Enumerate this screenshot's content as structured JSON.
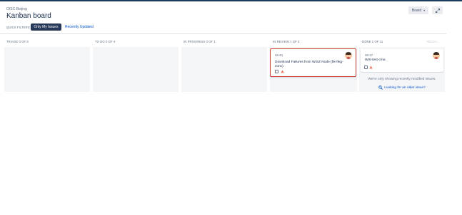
{
  "header": {
    "project": "OISC-Beijing",
    "title": "Kanban board",
    "board_label": "Board",
    "board_chevron": "▾",
    "expand_icon": "expand-icon"
  },
  "quick_filters": {
    "label": "QUICK FILTERS:",
    "items": [
      "Only My Issues",
      "Recently Updated"
    ]
  },
  "columns": [
    {
      "header": "TRIAGE 0 OF 8"
    },
    {
      "header": "TO DO 0 OF 4"
    },
    {
      "header": "IN PROGRESS 0 OF 1"
    },
    {
      "header": "IN REVIEW 1 OF 2"
    },
    {
      "header": "DONE 1 OF 11"
    }
  ],
  "columns_faded_tail": "RELEA...",
  "cards": [
    {
      "key": "WI-61",
      "summary": "Download Failures from WISZ Node (hk-hkg-zonc)",
      "selected": true
    },
    {
      "key": "WI-37",
      "summary": "IMS-test-cma",
      "selected": false
    }
  ],
  "done_notice": "We're only showing recently modified issues.",
  "done_older_link": "Looking for an older issue?",
  "colors": {
    "accent": "#0052cc",
    "filter_active": "#253858",
    "selected_border": "#d04437",
    "column_bg": "#f4f5f7"
  }
}
